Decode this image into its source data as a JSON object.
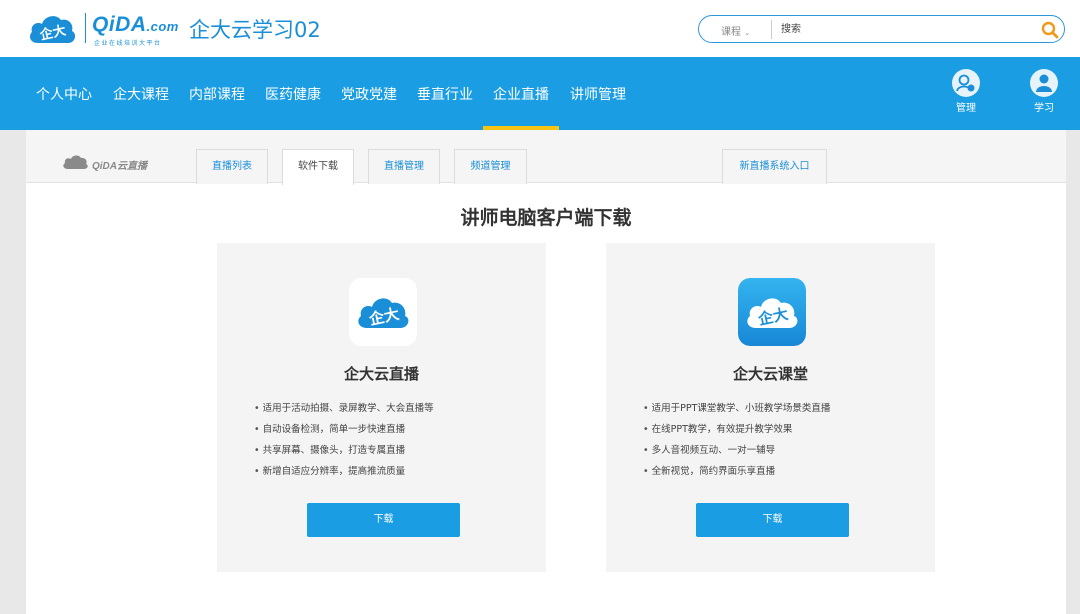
{
  "header": {
    "logo_word": "QiDA",
    "logo_com": ".com",
    "logo_tagline": "企业在线培训大平台",
    "site_title": "企大云学习02",
    "search": {
      "category": "课程",
      "placeholder": "搜索"
    }
  },
  "nav": {
    "items": [
      "个人中心",
      "企大课程",
      "内部课程",
      "医药健康",
      "党政党建",
      "垂直行业",
      "企业直播",
      "讲师管理"
    ],
    "active_index": 6,
    "tools": [
      {
        "label": "管理",
        "icon": "admin-user-icon"
      },
      {
        "label": "学习",
        "icon": "learn-user-icon"
      }
    ]
  },
  "subnav": {
    "logo_text": "QiDA云直播",
    "tabs": [
      "直播列表",
      "软件下载",
      "直播管理",
      "频道管理"
    ],
    "active_index": 1,
    "extra_tab": "新直播系统入口"
  },
  "main": {
    "title": "讲师电脑客户端下载",
    "cards": [
      {
        "name": "企大云直播",
        "icon": "qida-live-icon",
        "features": [
          "适用于活动拍摄、录屏教学、大会直播等",
          "自动设备检测，简单一步快速直播",
          "共享屏幕、摄像头，打造专属直播",
          "新增自适应分辨率，提高推流质量"
        ],
        "button": "下载"
      },
      {
        "name": "企大云课堂",
        "icon": "qida-classroom-icon",
        "features": [
          "适用于PPT课堂教学、小班教学场景类直播",
          "在线PPT教学，有效提升教学效果",
          "多人音视频互动、一对一辅导",
          "全新视觉，简约界面乐享直播"
        ],
        "button": "下载"
      }
    ]
  },
  "colors": {
    "brand_blue": "#1a9de3",
    "accent_yellow": "#f6c514"
  }
}
